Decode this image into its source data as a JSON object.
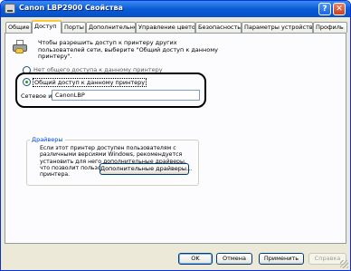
{
  "window": {
    "title": "Canon LBP2900 Свойства",
    "help_glyph": "?",
    "close_glyph": "✕"
  },
  "tabs": [
    {
      "label": "Общие"
    },
    {
      "label": "Доступ"
    },
    {
      "label": "Порты"
    },
    {
      "label": "Дополнительно"
    },
    {
      "label": "Управление цветом"
    },
    {
      "label": "Безопасность"
    },
    {
      "label": "Параметры устройства"
    },
    {
      "label": "Профиль"
    }
  ],
  "active_tab": "Доступ",
  "sharing": {
    "info_text": "Чтобы разрешить доступ к принтеру других пользователей сети, выберите \"Общий доступ к данному принтеру\".",
    "no_share_label": "Нет общего доступа к данному принтеру",
    "share_label": "Общий доступ к данному принтеру",
    "share_name_label": "Сетевое имя:",
    "share_name_value": "CanonLBP",
    "share_selected": true
  },
  "drivers": {
    "group_title": "Драйверы",
    "text": "Если этот принтер доступен пользователям с различными версиями Windows, рекомендуется установить для него дополнительные драйверы, что позволит пользователям не искать драйверы принтера.",
    "button_label": "Дополнительные драйверы..."
  },
  "footer": {
    "ok_label": "OK",
    "cancel_label": "Отмена",
    "apply_label": "Применить",
    "help_label": "Справка"
  },
  "colors": {
    "titlebar": "#0a5bd6",
    "tab_highlight": "#ffc83c",
    "group_title": "#0046d5",
    "radio_dot": "#21a121"
  }
}
